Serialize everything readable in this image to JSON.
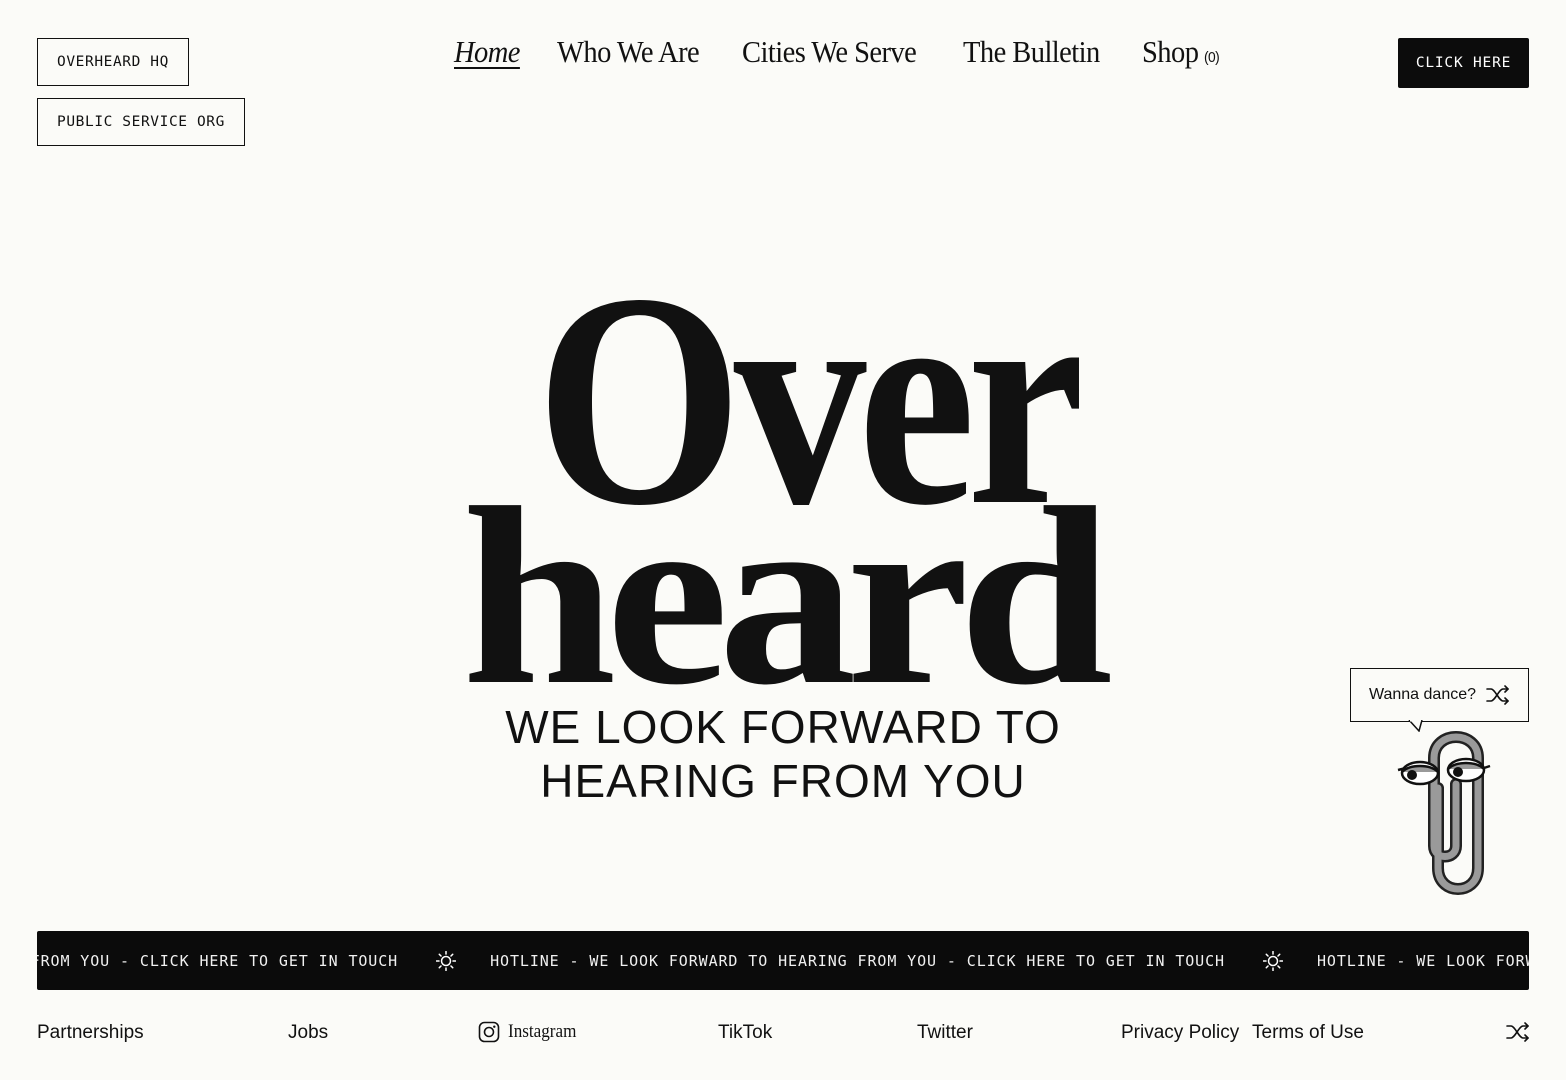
{
  "header": {
    "tag_hq": "OVERHEARD HQ",
    "tag_org": "PUBLIC SERVICE ORG",
    "nav": [
      "Home",
      "Who We Are",
      "Cities We Serve",
      "The Bulletin",
      "Shop"
    ],
    "cart_count": "(0)",
    "cta_label": "CLICK HERE"
  },
  "hero": {
    "logo_line1": "Over",
    "logo_line2": "heard",
    "tagline_line1": "WE LOOK FORWARD TO",
    "tagline_line2": "HEARING FROM YOU"
  },
  "assistant": {
    "bubble_text": "Wanna dance?",
    "icon": "shuffle-icon"
  },
  "ticker": {
    "segment_a": "RING FROM YOU - CLICK HERE TO GET IN TOUCH",
    "segment_b": "HOTLINE - WE LOOK FORWARD TO HEARING FROM YOU - CLICK HERE TO GET IN TOUCH",
    "segment_c": "HOTLINE - WE LOOK FORWARD TO",
    "separator_icon": "sun-icon"
  },
  "footer": {
    "partnerships": "Partnerships",
    "jobs": "Jobs",
    "instagram": "Instagram",
    "tiktok": "TikTok",
    "twitter": "Twitter",
    "privacy": "Privacy Policy",
    "terms": "Terms of Use"
  },
  "colors": {
    "background": "#fbfbf8",
    "ink": "#111111",
    "ticker_bg": "#0b0b0b"
  }
}
